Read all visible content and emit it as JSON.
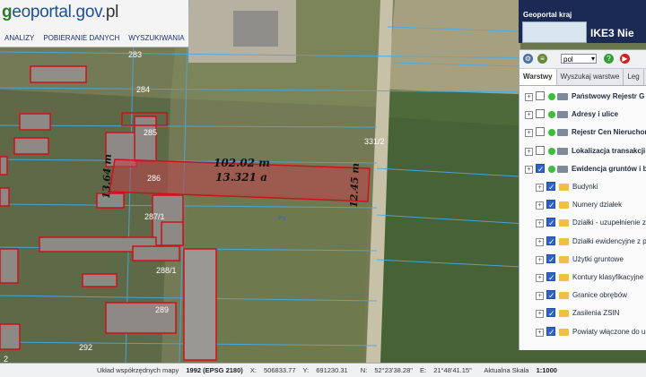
{
  "header": {
    "logo_prefix": "g",
    "logo_main": "eoportal.gov.",
    "logo_suffix": "pl",
    "menu": [
      "ANALIZY",
      "POBIERANIE DANYCH",
      "WYSZUKIWANIA"
    ]
  },
  "banner": {
    "title": "Geoportal kraj",
    "k3": "IKE3 Nie"
  },
  "map_labels": {
    "parcels": [
      "283",
      "284",
      "285",
      "286",
      "287/1",
      "288/1",
      "289",
      "292",
      "331/2",
      "2"
    ],
    "dim_top": "102.02 m",
    "area": "13.321 a",
    "dim_left": "13.64 m",
    "dim_right": "12.45 m",
    "ps_mark": "Ps"
  },
  "panel": {
    "lang": "pol",
    "tabs": [
      "Warstwy",
      "Wyszukaj warstwe",
      "Leg"
    ],
    "layers": [
      {
        "label": "Państwowy Rejestr G",
        "checked": false,
        "indent": 0,
        "type": "wms"
      },
      {
        "label": "Adresy i ulice",
        "checked": false,
        "indent": 0,
        "type": "wms"
      },
      {
        "label": "Rejestr Cen Nieruchom",
        "checked": false,
        "indent": 0,
        "type": "wms"
      },
      {
        "label": "Lokalizacja transakcji",
        "checked": false,
        "indent": 0,
        "type": "wms"
      },
      {
        "label": "Ewidencja gruntów i b",
        "checked": true,
        "indent": 0,
        "type": "wms"
      },
      {
        "label": "Budynki",
        "checked": true,
        "indent": 1,
        "type": "folder"
      },
      {
        "label": "Numery działek",
        "checked": true,
        "indent": 1,
        "type": "folder"
      },
      {
        "label": "Działki - uzupełnienie z",
        "checked": true,
        "indent": 1,
        "type": "folder"
      },
      {
        "label": "Działki ewidencyjne z p",
        "checked": true,
        "indent": 1,
        "type": "folder"
      },
      {
        "label": "Użytki gruntowe",
        "checked": true,
        "indent": 1,
        "type": "folder"
      },
      {
        "label": "Kontury klasyfikacyjne",
        "checked": true,
        "indent": 1,
        "type": "folder"
      },
      {
        "label": "Granice obrębów",
        "checked": true,
        "indent": 1,
        "type": "folder"
      },
      {
        "label": "Zasilenia ZSIN",
        "checked": true,
        "indent": 1,
        "type": "folder"
      },
      {
        "label": "Powiaty włączone do usł",
        "checked": true,
        "indent": 1,
        "type": "folder"
      }
    ]
  },
  "status": {
    "crs_label": "Układ współrzędnych mapy",
    "crs": "1992 (EPSG 2180)",
    "x_label": "X:",
    "x": "506833.77",
    "y_label": "Y:",
    "y": "691230.31",
    "n_label": "N:",
    "n": "52°23'38.28\"",
    "e_label": "E:",
    "e": "21°48'41.15\"",
    "scale_label": "Aktualna Skala",
    "scale": "1:1000"
  },
  "colors": {
    "parcel_outline": "#d0101a",
    "selected_fill": "#c0404a",
    "boundary_blue": "#4aa8e8"
  }
}
